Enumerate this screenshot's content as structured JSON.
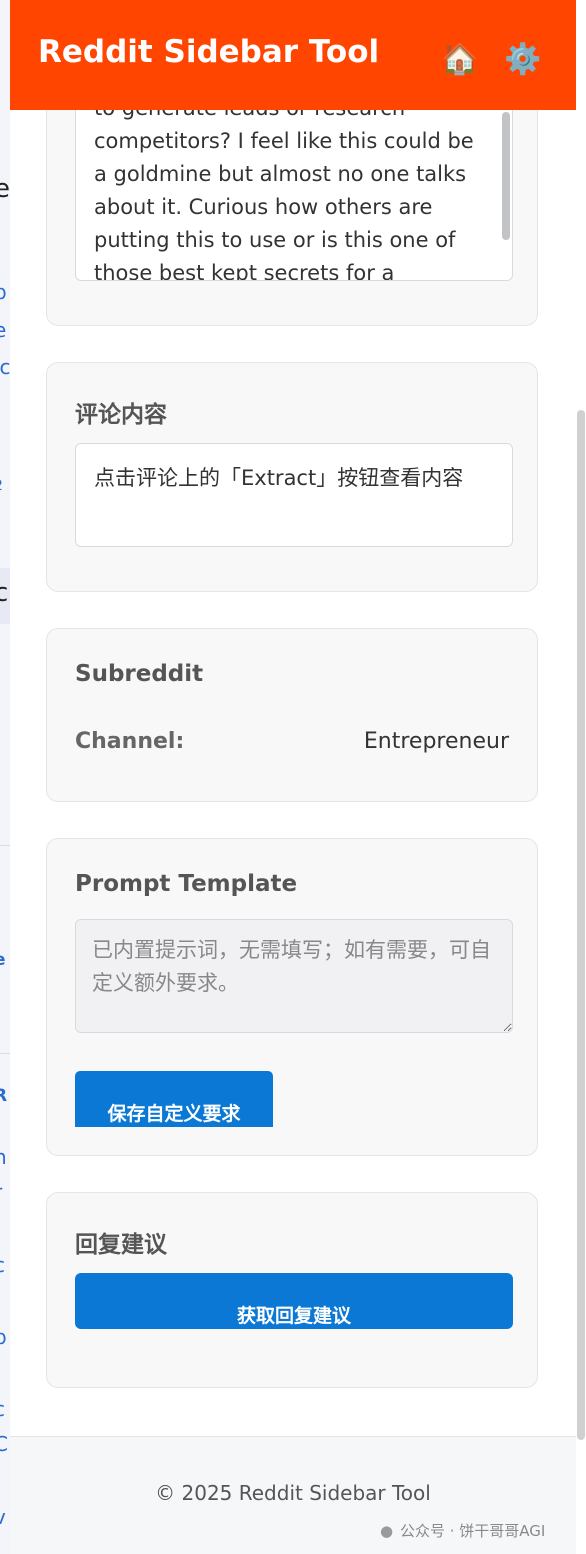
{
  "header": {
    "title": "Reddit Sidebar Tool",
    "home_icon": "🏠",
    "settings_icon": "⚙️"
  },
  "post": {
    "text": "to generate leads or research competitors? I feel like this could be a goldmine but almost no one talks about it. Curious how others are putting this to use or is this one of those best kept secrets for a"
  },
  "comment": {
    "title": "评论内容",
    "text": "点击评论上的「Extract」按钮查看内容"
  },
  "subreddit": {
    "title": "Subreddit",
    "channel_label": "Channel:",
    "channel_value": "Entrepreneur"
  },
  "prompt": {
    "title": "Prompt Template",
    "placeholder": "已内置提示词，无需填写；如有需要，可自定义额外要求。",
    "save_label": "保存自定义要求"
  },
  "reply": {
    "title": "回复建议",
    "button_label": "获取回复建议"
  },
  "footer": {
    "text": "© 2025 Reddit Sidebar Tool"
  },
  "background_page": {
    "fragments": [
      "e",
      "b",
      "e",
      "ic",
      "2",
      "c",
      "e",
      "R",
      "n",
      "r",
      "c",
      "p",
      "c",
      "C",
      "v"
    ]
  },
  "watermark": {
    "text": "公众号 · 饼干哥哥AGI"
  },
  "colors": {
    "header": "#ff4500",
    "button": "#0a78d4"
  }
}
